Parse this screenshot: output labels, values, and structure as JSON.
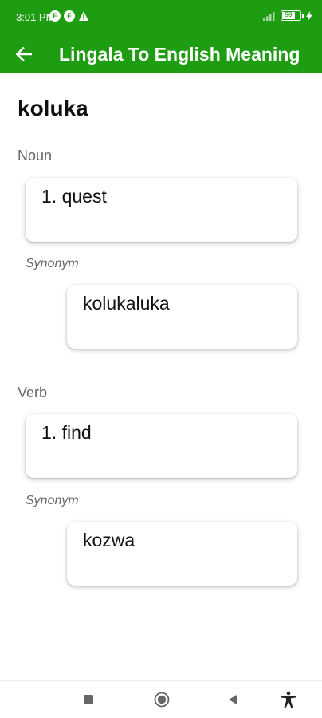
{
  "status": {
    "time": "3:01 PM",
    "icon_letter": "F",
    "battery": "99"
  },
  "toolbar": {
    "title": "Lingala To English Meaning"
  },
  "word": "koluka",
  "sections": [
    {
      "part_of_speech": "Noun",
      "meaning": "1. quest",
      "synonym_label": "Synonym",
      "synonym": "kolukaluka"
    },
    {
      "part_of_speech": "Verb",
      "meaning": "1. find",
      "synonym_label": "Synonym",
      "synonym": "kozwa"
    }
  ],
  "colors": {
    "appbar": "#1e9c12"
  },
  "icons": {
    "back": "arrow-left-icon",
    "nav_recents": "square-icon",
    "nav_home": "circle-icon",
    "nav_back": "triangle-icon",
    "accessibility": "accessibility-icon"
  }
}
